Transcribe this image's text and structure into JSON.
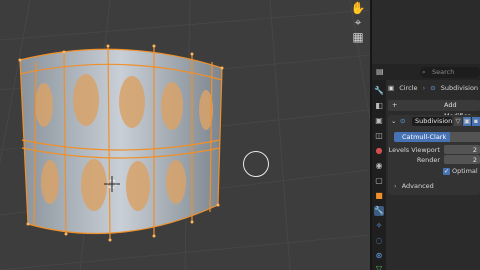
{
  "viewport": {
    "nav_icons": [
      "hand-icon",
      "camera-icon",
      "grid-icon"
    ]
  },
  "properties": {
    "search_placeholder": "Search",
    "breadcrumb": {
      "object": "Circle",
      "modifier": "Subdivision"
    },
    "add_modifier_label": "Add Modifier",
    "modifier": {
      "name": "Subdivision",
      "mode_active": "Catmull-Clark",
      "levels_viewport_label": "Levels Viewport",
      "levels_viewport_value": "2",
      "render_label": "Render",
      "render_value": "2",
      "optimal_display_label": "Optimal Dis",
      "advanced_label": "Advanced"
    },
    "colors": {
      "accent": "#4772b3",
      "selection": "#f0902a",
      "modifier_icon": "#5a9be0"
    }
  }
}
